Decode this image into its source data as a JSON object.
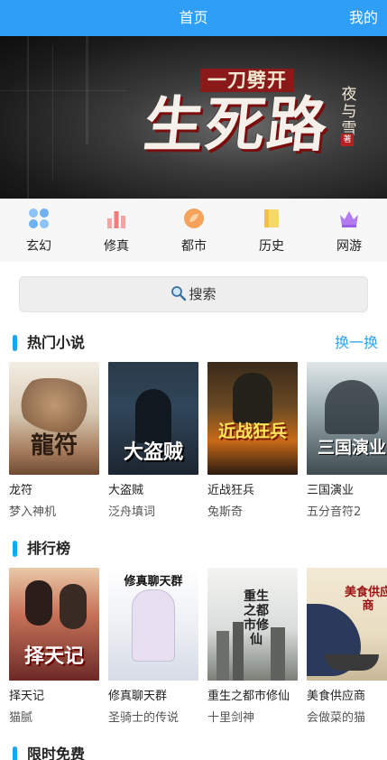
{
  "header": {
    "title": "首页",
    "mine_label": "我的"
  },
  "banner": {
    "subtitle": "一刀劈开",
    "title": "生死路",
    "author": "夜与雪",
    "seal": "著"
  },
  "categories": [
    {
      "label": "玄幻",
      "icon": "dots-grid-icon",
      "color": "#8cc2f5"
    },
    {
      "label": "修真",
      "icon": "bar-chart-icon",
      "color": "#f47c7c"
    },
    {
      "label": "都市",
      "icon": "leaf-circle-icon",
      "color": "#f5a35c"
    },
    {
      "label": "历史",
      "icon": "notebook-icon",
      "color": "#f6d76a"
    },
    {
      "label": "网游",
      "icon": "crown-icon",
      "color": "#b27cf0"
    }
  ],
  "search": {
    "label": "搜索"
  },
  "hot": {
    "title": "热门小说",
    "more_label": "换一换",
    "books": [
      {
        "name": "龙符",
        "author": "梦入神机",
        "cover_text": "龍符"
      },
      {
        "name": "大盗贼",
        "author": "泛舟填词",
        "cover_text": "大盗贼"
      },
      {
        "name": "近战狂兵",
        "author": "兔斯奇",
        "cover_text": "近战狂兵"
      },
      {
        "name": "三国演业",
        "author": "五分音符2",
        "cover_text": "三国演业"
      }
    ]
  },
  "rank": {
    "title": "排行榜",
    "books": [
      {
        "name": "择天记",
        "author": "猫腻",
        "cover_text": "择天记"
      },
      {
        "name": "修真聊天群",
        "author": "圣骑士的传说",
        "cover_text": "修真聊天群"
      },
      {
        "name": "重生之都市修仙",
        "author": "十里剑神",
        "cover_text": "重生之都市修仙"
      },
      {
        "name": "美食供应商",
        "author": "会做菜的猫",
        "cover_text": "美食供应商"
      }
    ]
  },
  "free": {
    "title": "限时免费"
  }
}
